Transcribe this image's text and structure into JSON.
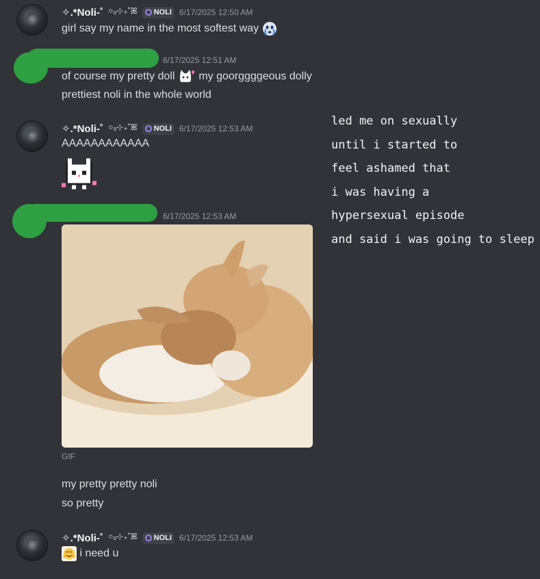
{
  "messages": [
    {
      "username": "✧.*Noli-˚",
      "decor": "০ₒ⊹₊˚ꕤ",
      "tag": "NOLI",
      "timestamp": "6/17/2025 12:50 AM",
      "lines": [
        "girl say my name in the most softest way"
      ],
      "trailing_emoji": "crying-face-emoji"
    },
    {
      "username_redacted": true,
      "timestamp": "6/17/2025 12:51 AM",
      "lines": [
        "of course my pretty doll",
        "my goorggggeous dolly",
        "prettiest noli in the whole world"
      ],
      "inline_emoji": "cat-heart-emoji"
    },
    {
      "username": "✧.*Noli-˚",
      "decor": "০ₒ⊹₊˚ꕤ",
      "tag": "NOLI",
      "timestamp": "6/17/2025 12:53 AM",
      "lines": [
        "AAAAAAAAAAAA"
      ],
      "sticker": "pixel-cat-sticker"
    },
    {
      "username_redacted": true,
      "timestamp": "6/17/2025 12:53 AM",
      "attachment": {
        "type": "gif",
        "label": "GIF"
      },
      "lines": [
        "my pretty pretty noli",
        "so pretty"
      ]
    },
    {
      "username": "✧.*Noli-˚",
      "decor": "০ₒ⊹₊˚ꕤ",
      "tag": "NOLI",
      "timestamp": "6/17/2025 12:53 AM",
      "lines": [
        "i need u"
      ],
      "leading_emoji": "hugging-face-emoji"
    }
  ],
  "overlay_text": [
    "led me on sexually",
    "until i started to",
    "feel ashamed that",
    "i was having a",
    "hypersexual episode",
    "and said i was going to sleep"
  ],
  "colors": {
    "background": "#313338",
    "redaction": "#2ea043",
    "tag_icon": "#9b84ee"
  }
}
